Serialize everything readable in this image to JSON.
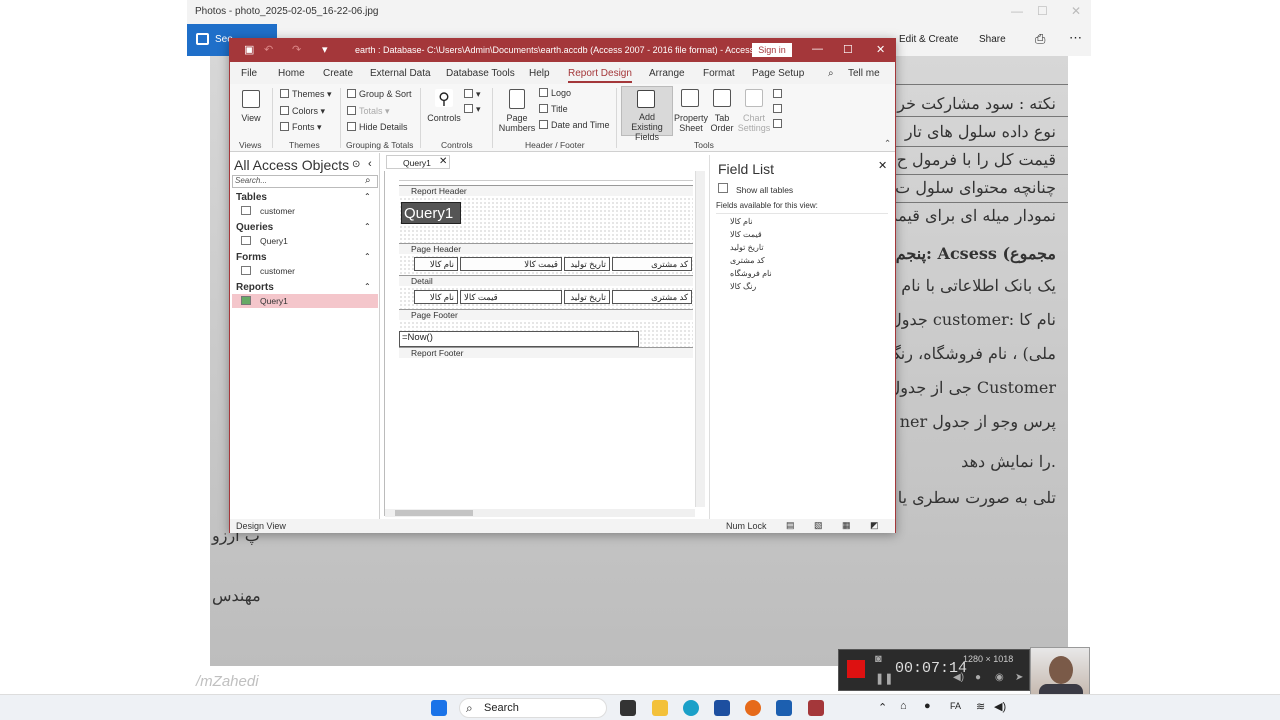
{
  "photos": {
    "title": "Photos - photo_2025-02-05_16-22-06.jpg",
    "see_label": "See",
    "edit_create": "Edit & Create",
    "share": "Share"
  },
  "photo_lines": [
    "نکته : سود مشارکت خر",
    "نوع داده سلول های تار",
    "قیمت کل را با فرمول ح",
    "چنانچه محتوای سلول ت",
    "نمودار میله ای برای قیمه",
    "پنجم: Acsess (مجموع",
    "یک بانک اطلاعاتی با نام",
    "جدول customer: نام کا",
    "ملی) ، نام فروشگاه، رنگ",
    "جی از جدول Customer",
    "ner پرس وجو از جدول",
    "را نمایش دهد.",
    "تلی به صورت سطری یا"
  ],
  "photo_bottom": [
    "پ ارزو",
    "مهندس"
  ],
  "watermark": "/mZahedi",
  "access": {
    "title": "earth : Database- C:\\Users\\Admin\\Documents\\earth.accdb (Access 2007 - 2016 file format) - Access",
    "signin": "Sign in",
    "menu": [
      "File",
      "Home",
      "Create",
      "External Data",
      "Database Tools",
      "Help",
      "Report Design",
      "Arrange",
      "Format",
      "Page Setup"
    ],
    "tell_me": "Tell me",
    "ribbon": {
      "view": "View",
      "themes": "Themes",
      "colors": "Colors",
      "fonts": "Fonts",
      "group_sort": "Group & Sort",
      "totals": "Totals",
      "hide_details": "Hide Details",
      "controls": "Controls",
      "page_numbers": [
        "Page",
        "Numbers"
      ],
      "logo": "Logo",
      "title": "Title",
      "date_time": "Date and Time",
      "add_fields": [
        "Add Existing",
        "Fields"
      ],
      "property": [
        "Property",
        "Sheet"
      ],
      "tab_order": [
        "Tab",
        "Order"
      ],
      "chart": [
        "Chart",
        "Settings"
      ]
    },
    "groups": [
      "Views",
      "Themes",
      "Grouping & Totals",
      "Controls",
      "Header / Footer",
      "Tools"
    ],
    "nav": {
      "title": "All Access Objects",
      "search": "Search...",
      "tables": "Tables",
      "customer": "customer",
      "queries": "Queries",
      "query1": "Query1",
      "forms": "Forms",
      "forms_customer": "customer",
      "reports": "Reports",
      "reports_query1": "Query1"
    },
    "doc_tab": "Query1",
    "sections": {
      "report_header": "Report Header",
      "page_header": "Page Header",
      "detail": "Detail",
      "page_footer": "Page Footer",
      "report_footer": "Report Footer"
    },
    "report_title": "Query1",
    "page_header_labels": [
      "نام کالا",
      "قیمت کالا",
      "تاریخ تولید",
      "کد مشتری"
    ],
    "detail_fields": [
      "نام کالا",
      "قیمت کالا",
      "تاریخ تولید",
      "کد مشتری"
    ],
    "footer_expr": "=Now()",
    "field_list": {
      "title": "Field List",
      "show_all": "Show all tables",
      "available": "Fields available for this view:",
      "fields": [
        "نام کالا",
        "قیمت کالا",
        "تاریخ تولید",
        "کد مشتری",
        "نام فروشگاه",
        "رنگ کالا"
      ]
    },
    "status": {
      "left": "Design View",
      "num_lock": "Num Lock"
    }
  },
  "taskbar": {
    "search": "Search",
    "lang": "FA"
  },
  "recorder": {
    "time": "00:07:14",
    "resolution": "1280 × 1018"
  }
}
